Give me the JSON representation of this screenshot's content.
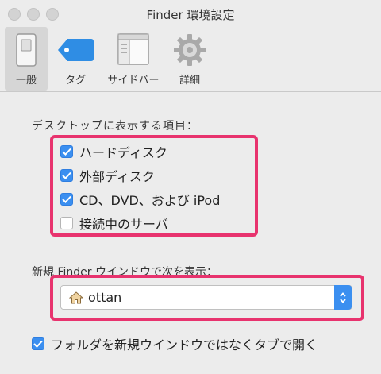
{
  "window": {
    "title": "Finder 環境設定"
  },
  "toolbar": {
    "tabs": [
      {
        "label": "一般",
        "icon": "switch-icon",
        "selected": true
      },
      {
        "label": "タグ",
        "icon": "tag-icon",
        "selected": false
      },
      {
        "label": "サイドバー",
        "icon": "sidebar-icon",
        "selected": false
      },
      {
        "label": "詳細",
        "icon": "gear-icon",
        "selected": false
      }
    ]
  },
  "desktop_section": {
    "heading": "デスクトップに表示する項目：",
    "items": [
      {
        "label": "ハードディスク",
        "checked": true
      },
      {
        "label": "外部ディスク",
        "checked": true
      },
      {
        "label": "CD、DVD、および iPod",
        "checked": true
      },
      {
        "label": "接続中のサーバ",
        "checked": false
      }
    ]
  },
  "new_window_section": {
    "heading": "新規 Finder ウインドウで次を表示：",
    "selected_value": "ottan",
    "icon": "home-icon"
  },
  "open_folders_option": {
    "label": "フォルダを新規ウインドウではなくタブで開く",
    "checked": true
  },
  "colors": {
    "accent": "#3b8ff0",
    "highlight": "#e8336e"
  }
}
